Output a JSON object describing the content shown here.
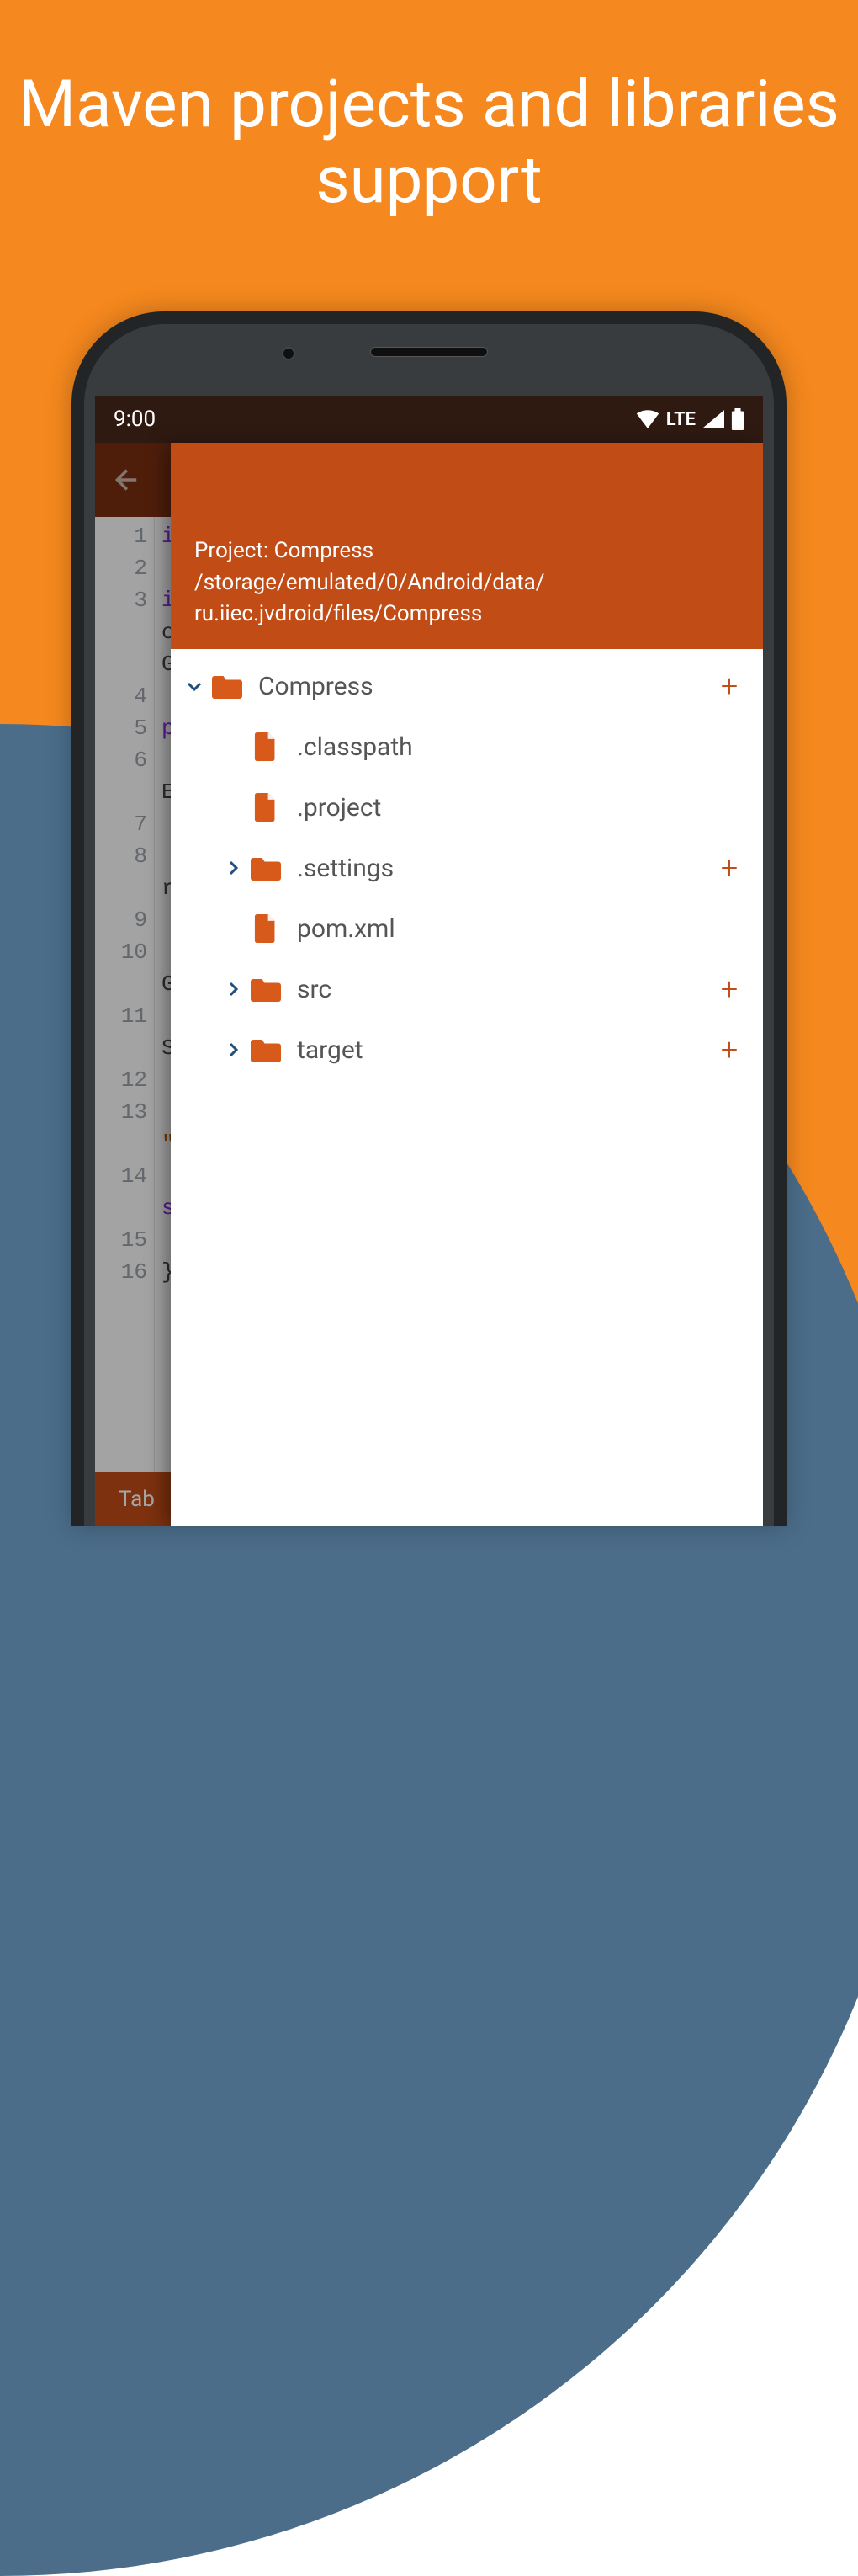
{
  "headline": "Maven projects and libraries support",
  "status": {
    "time": "9:00",
    "network": "LTE"
  },
  "drawer": {
    "title": "Project: Compress",
    "path_line1": "/storage/emulated/0/Android/data/",
    "path_line2": "ru.iiec.jvdroid/files/Compress"
  },
  "tree": {
    "root": {
      "name": "Compress",
      "expanded": true,
      "has_add": true
    },
    "children": [
      {
        "type": "file",
        "name": ".classpath"
      },
      {
        "type": "file",
        "name": ".project"
      },
      {
        "type": "folder",
        "name": ".settings",
        "has_add": true
      },
      {
        "type": "file",
        "name": "pom.xml"
      },
      {
        "type": "folder",
        "name": "src",
        "has_add": true
      },
      {
        "type": "folder",
        "name": "target",
        "has_add": true
      }
    ]
  },
  "editor": {
    "line_numbers": [
      "1",
      "2",
      "3",
      "4",
      "5",
      "6",
      "7",
      "8",
      "9",
      "10",
      "11",
      "12",
      "13",
      "14",
      "15",
      "16"
    ],
    "fragments": {
      "l1": "i",
      "l3a": "i",
      "l3b": "c",
      "l3c": "G",
      "l5a": "p",
      "l6a": "E",
      "l8a": "r",
      "l10a": "G",
      "l11a": "S",
      "l13a": "\"",
      "l14a": "s",
      "l16a": "}"
    }
  },
  "bottom": {
    "tab_label": "Tab"
  },
  "colors": {
    "accent": "#C14C16",
    "folder": "#D85A1A",
    "chevron_blue": "#224f7c"
  }
}
